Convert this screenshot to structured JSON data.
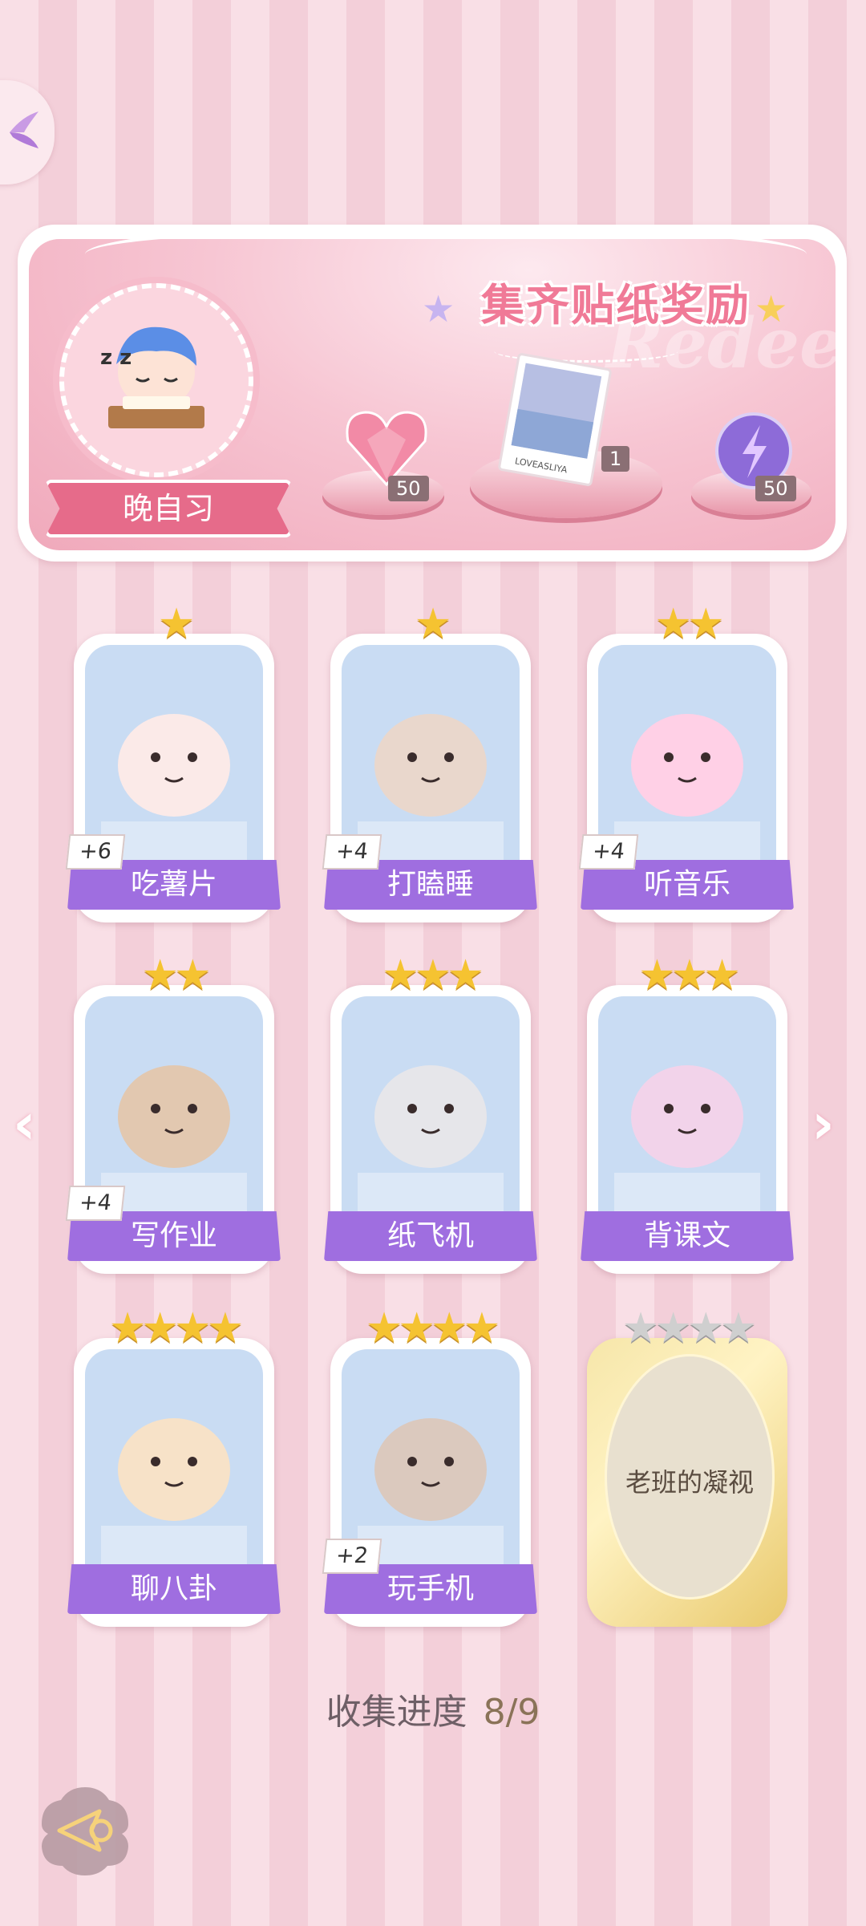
{
  "banner": {
    "title": "集齐贴纸奖励",
    "watermark": "Redeem",
    "level_name": "晚自习",
    "rewards": [
      {
        "icon": "heart-gem-icon",
        "count": "50"
      },
      {
        "icon": "photo-card-icon",
        "count": "1"
      },
      {
        "icon": "energy-orb-icon",
        "count": "50"
      }
    ]
  },
  "cards": [
    {
      "name": "吃薯片",
      "stars": 1,
      "bonus": "+6",
      "icon": "cat-eating-chips-icon",
      "locked": false
    },
    {
      "name": "打瞌睡",
      "stars": 1,
      "bonus": "+4",
      "icon": "boy-sleeping-icon",
      "locked": false
    },
    {
      "name": "听音乐",
      "stars": 2,
      "bonus": "+4",
      "icon": "girl-headphones-icon",
      "locked": false
    },
    {
      "name": "写作业",
      "stars": 2,
      "bonus": "+4",
      "icon": "boy-writing-icon",
      "locked": false
    },
    {
      "name": "纸飞机",
      "stars": 3,
      "bonus": "",
      "icon": "cat-paper-plane-icon",
      "locked": false
    },
    {
      "name": "背课文",
      "stars": 3,
      "bonus": "",
      "icon": "girl-reciting-icon",
      "locked": false
    },
    {
      "name": "聊八卦",
      "stars": 4,
      "bonus": "",
      "icon": "dog-watermelon-icon",
      "locked": false
    },
    {
      "name": "玩手机",
      "stars": 4,
      "bonus": "+2",
      "icon": "girl-phone-icon",
      "locked": false
    },
    {
      "name": "老班的凝视",
      "stars": 4,
      "bonus": "",
      "icon": "locked-card-icon",
      "locked": true
    }
  ],
  "progress": {
    "label": "收集进度",
    "value": "8/9"
  },
  "colors": {
    "accent": "#9f6ee0",
    "pink": "#f07a97",
    "star": "#f5c331"
  }
}
